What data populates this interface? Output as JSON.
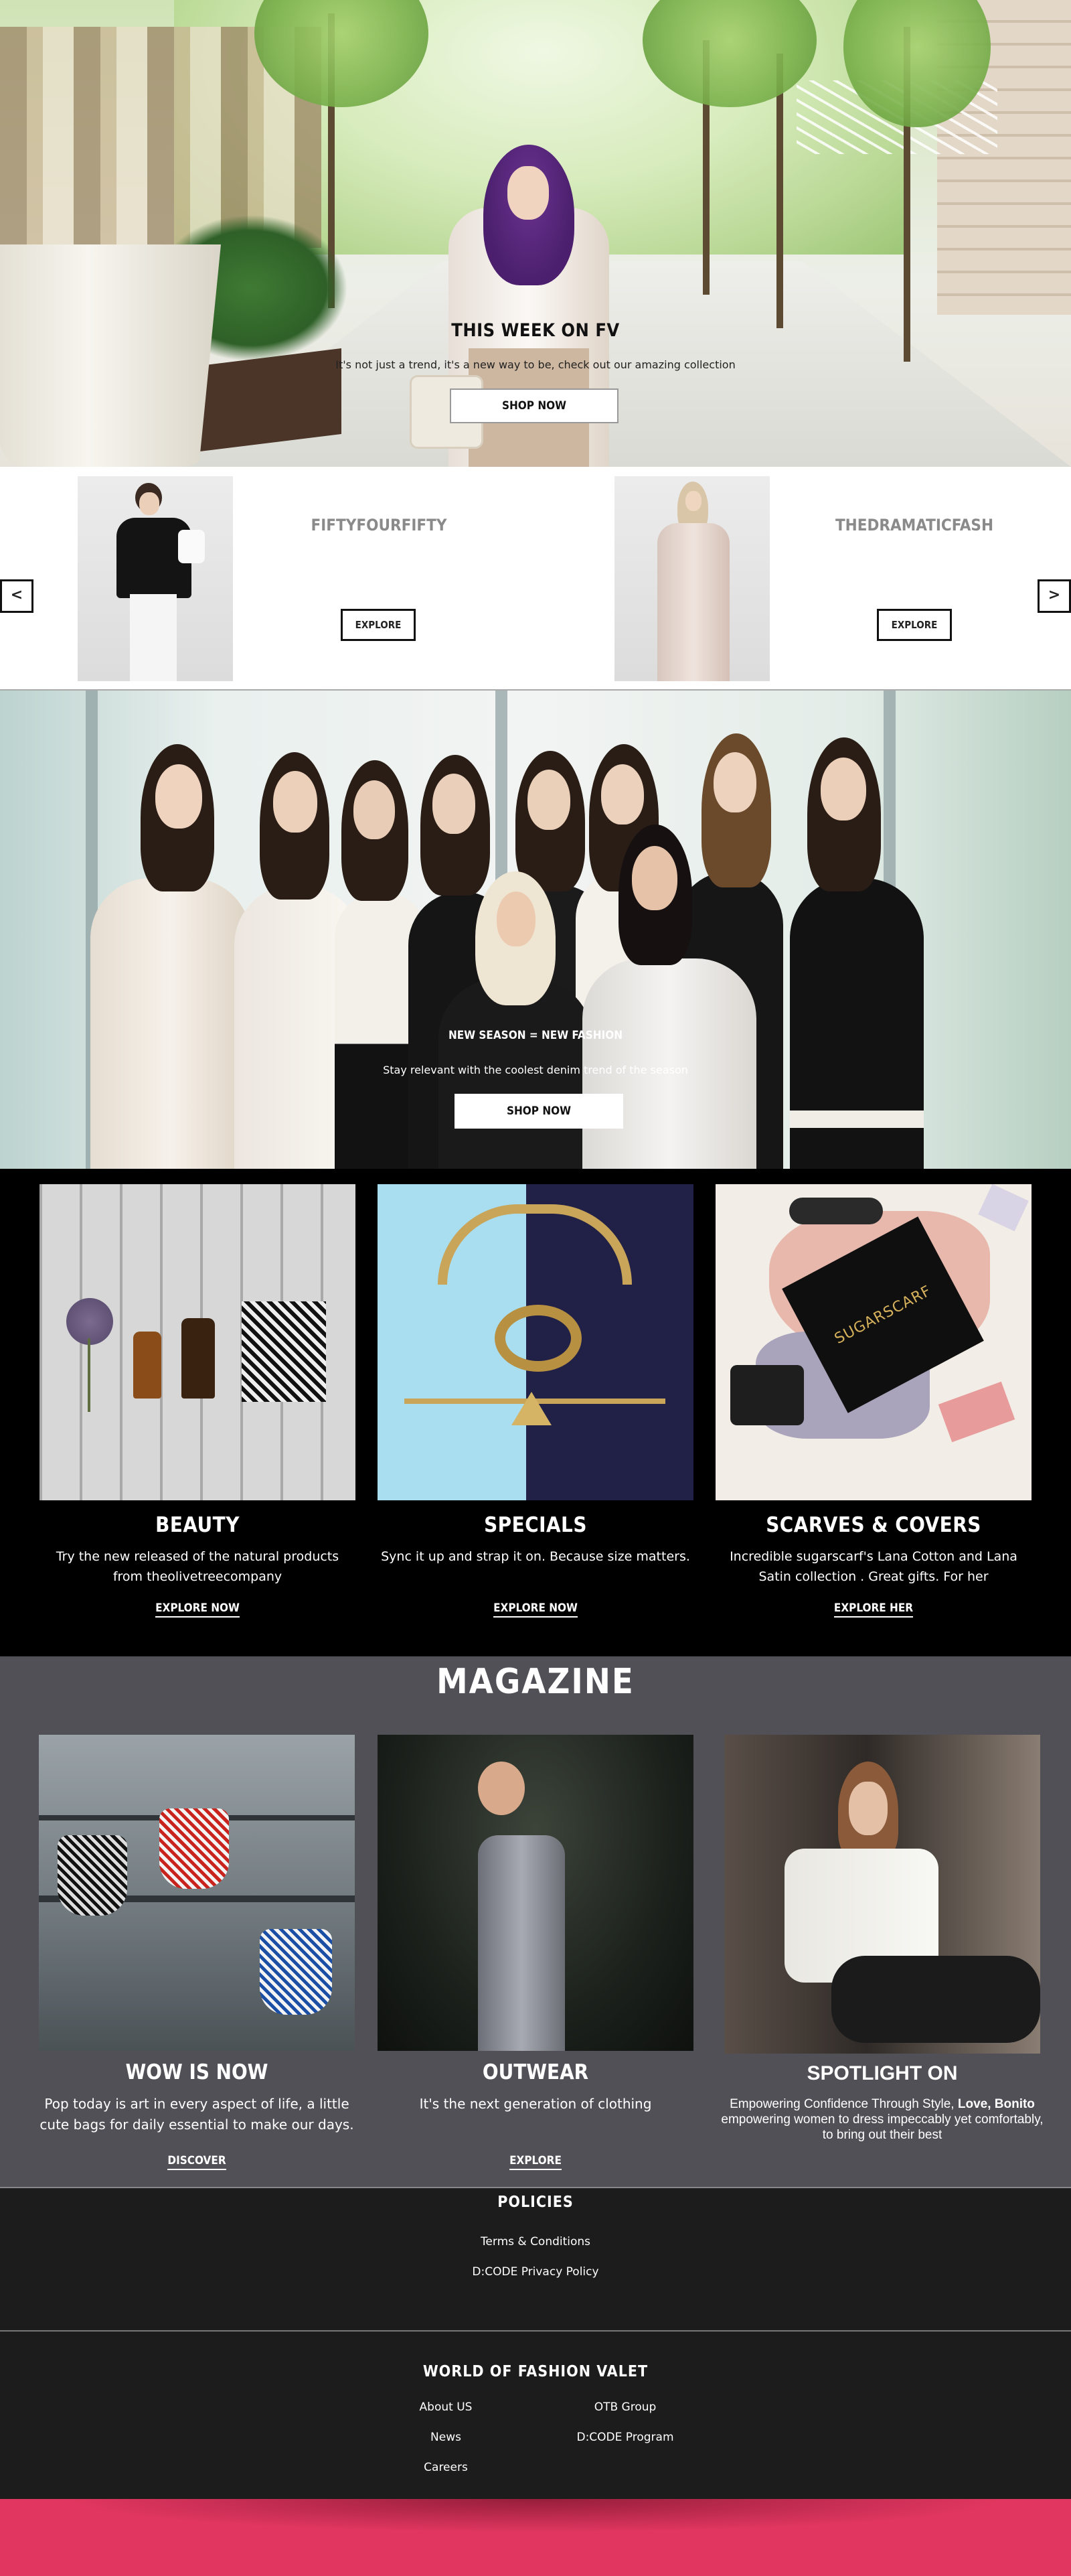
{
  "hero": {
    "title": "THIS WEEK ON FV",
    "subtitle": "It's not just a trend, it's a new way to be, check out our amazing collection",
    "cta": "SHOP NOW"
  },
  "carousel": {
    "prev_label": "<",
    "next_label": ">",
    "items": [
      {
        "brand": "FIFTYFOURFIFTY",
        "cta": "EXPLORE"
      },
      {
        "brand": "THEDRAMATICFASH",
        "cta": "EXPLORE"
      }
    ]
  },
  "season": {
    "title": "NEW SEASON = NEW FASHION",
    "subtitle": "Stay relevant with the coolest denim trend of the season",
    "cta": "SHOP NOW"
  },
  "categories": [
    {
      "title": "BEAUTY",
      "text": "Try the new released of the natural products from theolivetreecompany",
      "link": "EXPLORE NOW"
    },
    {
      "title": "SPECIALS",
      "text": "Sync it up and strap it on. Because size matters.",
      "link": "EXPLORE NOW"
    },
    {
      "title": "SCARVES & COVERS",
      "text": "Incredible sugarscarf's Lana Cotton and Lana Satin collection . Great gifts. For her",
      "link": "EXPLORE HER",
      "box_text": "SUGARSCARF"
    }
  ],
  "magazine": {
    "heading": "MAGAZINE",
    "items": [
      {
        "title": "WOW IS NOW",
        "text": "Pop today is art in every aspect of life, a little cute bags for daily essential to make our days.",
        "link": "DISCOVER"
      },
      {
        "title": "OUTWEAR",
        "text": "It's the next generation of clothing",
        "link": "EXPLORE"
      },
      {
        "title": "SPOTLIGHT ON",
        "text_prefix": "Empowering Confidence Through Style, ",
        "text_bold": "Love, Bonito",
        "text_suffix": " empowering women to dress impeccably yet comfortably, to bring out their best"
      }
    ]
  },
  "policies": {
    "heading": "POLICIES",
    "links": [
      "Terms & Conditions",
      "D:CODE Privacy Policy"
    ]
  },
  "world": {
    "heading": "WORLD OF FASHION VALET",
    "links_left": [
      "About US",
      "News",
      "Careers"
    ],
    "links_right": [
      "OTB Group",
      "D:CODE Program"
    ]
  },
  "colors": {
    "black": "#000000",
    "magazine_bg": "#515057",
    "footer_bg": "#1c1c1c",
    "pink": "#e0365f"
  }
}
